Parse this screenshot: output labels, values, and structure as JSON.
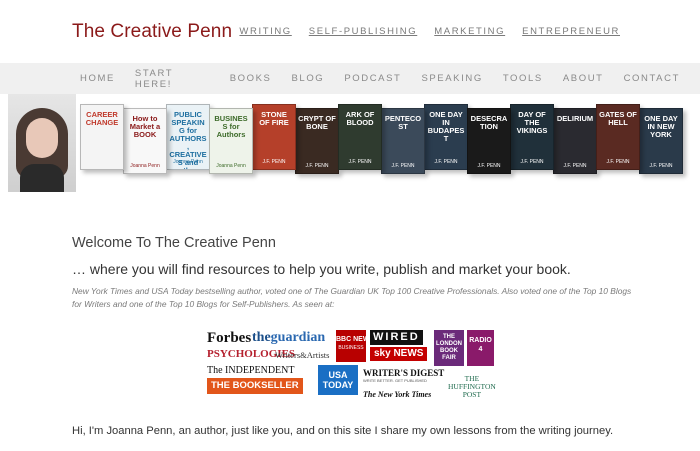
{
  "header": {
    "site_title": "The Creative Penn",
    "top_links": [
      "WRITING",
      "SELF-PUBLISHING",
      "MARKETING",
      "ENTREPRENEUR"
    ]
  },
  "main_nav": [
    "HOME",
    "START HERE!",
    "BOOKS",
    "BLOG",
    "PODCAST",
    "SPEAKING",
    "TOOLS",
    "ABOUT",
    "CONTACT"
  ],
  "banner": {
    "books": [
      {
        "title": "CAREER CHANGE",
        "author": "",
        "color": "#f4f4f4",
        "text_color": "#c0392b"
      },
      {
        "title": "How to Market a BOOK",
        "author": "Joanna Penn",
        "color": "#f8f8f8",
        "text_color": "#8b1a1a"
      },
      {
        "title": "PUBLIC SPEAKING for AUTHORS, CREATIVES and other INTROVERTS",
        "author": "Joanna Penn",
        "color": "#eaf2f6",
        "text_color": "#1e6fa0"
      },
      {
        "title": "BUSINESS for Authors",
        "author": "Joanna Penn",
        "color": "#eef3ea",
        "text_color": "#3d6b2a"
      },
      {
        "title": "STONE OF FIRE",
        "author": "J.F. PENN",
        "color": "#b5402a",
        "text_color": "#ffffff"
      },
      {
        "title": "CRYPT OF BONE",
        "author": "J.F. PENN",
        "color": "#3a2a22",
        "text_color": "#ffffff"
      },
      {
        "title": "ARK OF BLOOD",
        "author": "J.F. PENN",
        "color": "#2f3b2f",
        "text_color": "#ffffff"
      },
      {
        "title": "PENTECOST",
        "author": "J.F. PENN",
        "color": "#3b4a5a",
        "text_color": "#ffffff"
      },
      {
        "title": "ONE DAY IN BUDAPEST",
        "author": "J.F. PENN",
        "color": "#2b3d4f",
        "text_color": "#ffffff"
      },
      {
        "title": "DESECRATION",
        "author": "J.F. PENN",
        "color": "#1a1a1a",
        "text_color": "#ffffff"
      },
      {
        "title": "DAY OF THE VIKINGS",
        "author": "J.F. PENN",
        "color": "#20303a",
        "text_color": "#ffffff"
      },
      {
        "title": "DELIRIUM",
        "author": "J.F. PENN",
        "color": "#2a2a30",
        "text_color": "#ffffff"
      },
      {
        "title": "GATES OF HELL",
        "author": "J.F. PENN",
        "color": "#5a2a22",
        "text_color": "#ffffff"
      },
      {
        "title": "ONE DAY IN NEW YORK",
        "author": "J.F. PENN",
        "color": "#2a3a4a",
        "text_color": "#ffffff"
      }
    ]
  },
  "content": {
    "welcome": "Welcome To The Creative Penn",
    "tagline": "… where you will find resources to help you write, publish and market your book.",
    "blurb": "New York Times and USA Today bestselling author, voted one of The Guardian UK Top 100 Creative Professionals. Also voted one of the Top 10 Blogs for Writers and one of the Top 10 Blogs for Self-Publishers. As seen at:",
    "closing": "Hi, I'm Joanna Penn, an author, just like you, and on this site I share my own lessons from the writing journey."
  },
  "media_logos": {
    "forbes": "Forbes",
    "guardian_the": "the",
    "guardian": "guardian",
    "bbc_news": "BBC NEWS",
    "bbc_business": "BUSINESS",
    "wired": "WIRED",
    "london_book_fair": "THE LONDON BOOK FAIR",
    "radio4": "RADIO 4",
    "psychologies": "PSYCHOLOGIES",
    "writers_artists": "Writers&Artists",
    "sky_news": "sky NEWS",
    "independent": "The INDEPENDENT",
    "usa_today": "USA TODAY",
    "writers_digest": "WRITER'S DIGEST",
    "writers_digest_sub": "WRITE BETTER. GET PUBLISHED",
    "huffington_the": "THE",
    "huffington": "HUFFINGTON",
    "huffington_post": "POST",
    "bookseller": "THE BOOKSELLER",
    "nytimes": "The New York Times"
  }
}
